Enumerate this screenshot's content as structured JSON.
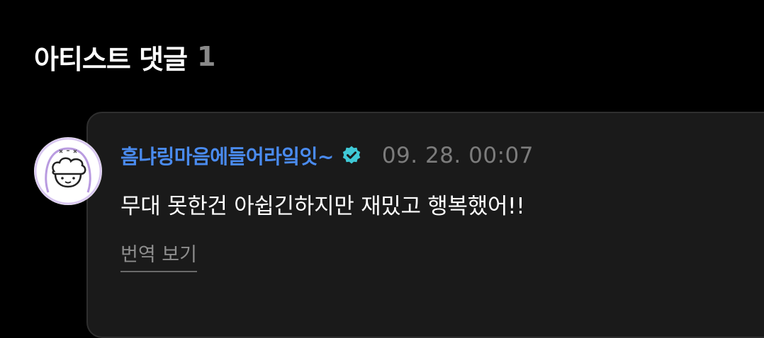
{
  "header": {
    "title": "아티스트 댓글",
    "count": "1"
  },
  "comment": {
    "author": "흠냐링마음에들어라잌잇~",
    "verified_icon": "verified-badge-icon",
    "timestamp": "09. 28. 00:07",
    "text": "무대 못한건 아쉽긴하지만 재밌고 행복했어!!",
    "translate_label": "번역 보기"
  },
  "colors": {
    "background": "#000000",
    "card_background": "#1a1a1a",
    "author_name": "#4a8bef",
    "verified_badge": "#3fc9d6",
    "timestamp": "#7c7c7c",
    "count": "#8a8a8a"
  }
}
